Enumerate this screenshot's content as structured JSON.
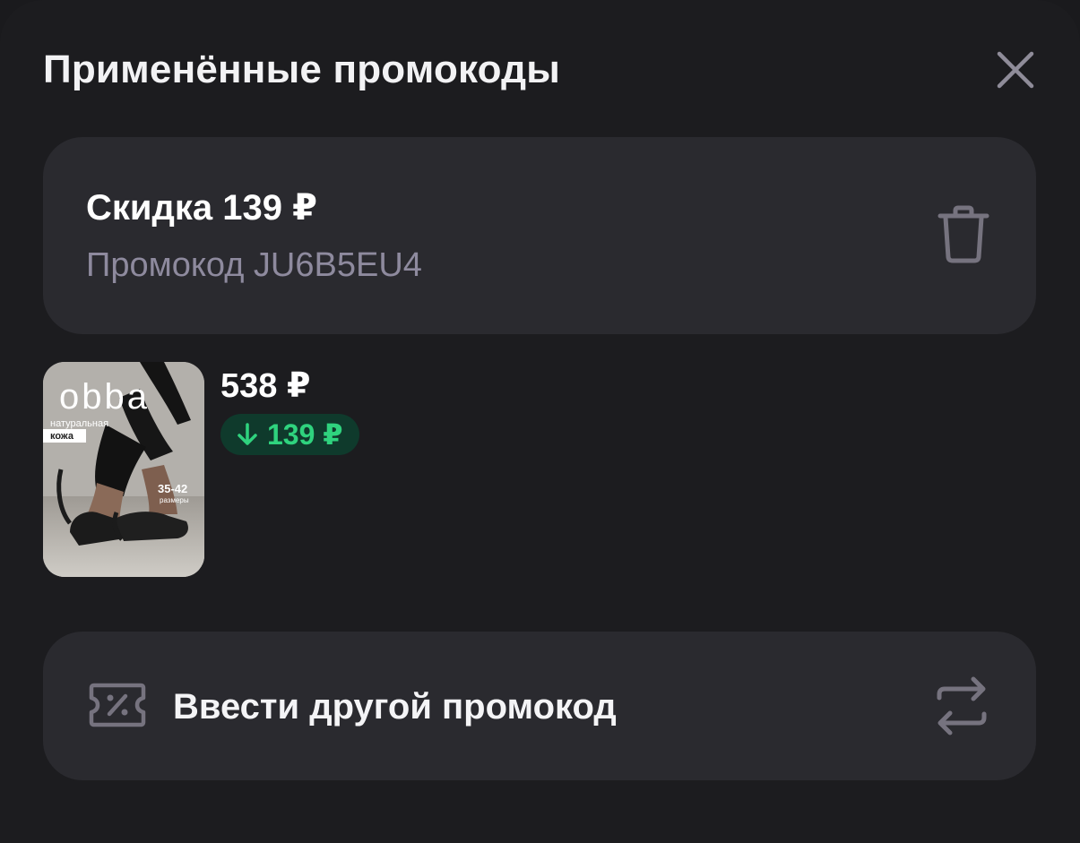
{
  "header": {
    "title": "Применённые промокоды",
    "close_icon": "close-icon"
  },
  "promo": {
    "discount": "Скидка 139 ₽",
    "code": "Промокод JU6B5EU4",
    "delete_icon": "trash-icon"
  },
  "product": {
    "image_brand": "obba",
    "image_tag_1": "натуральная",
    "image_tag_2": "кожа",
    "image_sizes": "35-42",
    "image_sizes_label": "размеры",
    "price": "538 ₽",
    "discount": "139 ₽",
    "discount_icon": "arrow-down-icon"
  },
  "enter_other": {
    "label": "Ввести другой промокод",
    "icon": "ticket-percent-icon",
    "action_icon": "swap-arrows-icon"
  },
  "colors": {
    "background": "#1c1c1f",
    "card": "#2a2a2f",
    "secondary_text": "#8e8a9e",
    "discount_green": "#2fd37e",
    "discount_badge_bg": "#0f3a2c"
  }
}
